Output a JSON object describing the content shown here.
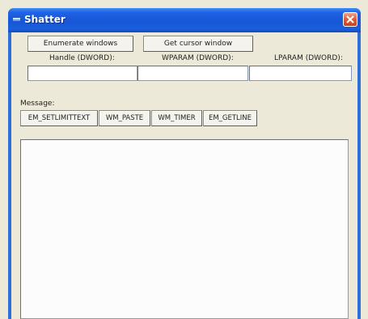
{
  "window": {
    "title": "Shatter",
    "title_color": "#ffffff",
    "titlebar_color": "#1756d6",
    "close_button_color": "#e0603a"
  },
  "toolbar": {
    "enumerate_label": "Enumerate windows",
    "cursor_label": "Get cursor window"
  },
  "params": {
    "handle_label": "Handle (DWORD):",
    "handle_value": "",
    "wparam_label": "WPARAM (DWORD):",
    "wparam_value": "",
    "lparam_label": "LPARAM (DWORD):",
    "lparam_value": ""
  },
  "message": {
    "label": "Message:",
    "buttons": [
      "EM_SETLIMITTEXT",
      "WM_PASTE",
      "WM_TIMER",
      "EM_GETLINE"
    ]
  },
  "output": {
    "value": ""
  },
  "icons": {
    "system_menu": "window-menu-icon",
    "close": "close-icon"
  }
}
